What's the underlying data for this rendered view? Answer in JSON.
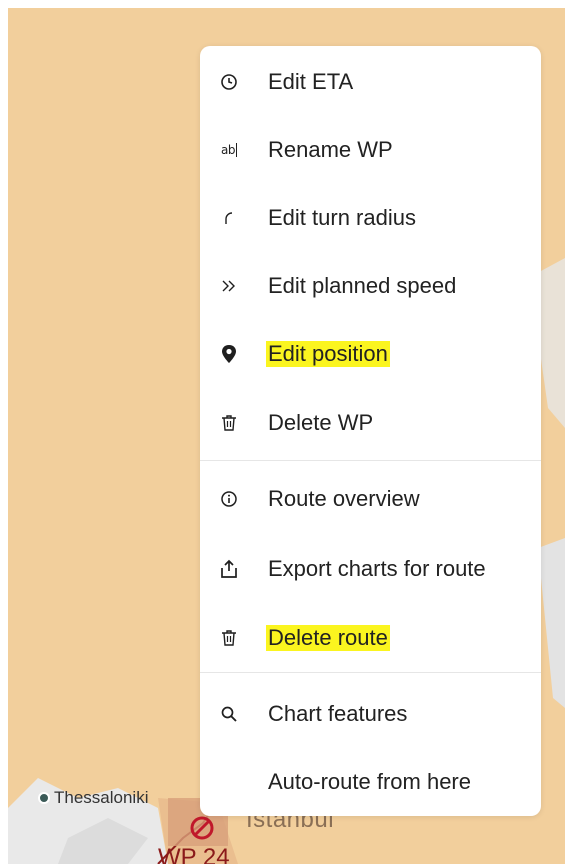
{
  "map": {
    "city_label": "Thessaloniki",
    "istanbul_label": "Istanbul",
    "waypoint_label": "WP 24",
    "colors": {
      "land": "#f2cf9c",
      "sea": "#e6e6e6",
      "route": "#8b1a1a"
    }
  },
  "context_menu": {
    "items": [
      {
        "label": "Edit ETA",
        "icon": "clock-icon",
        "highlighted": false
      },
      {
        "label": "Rename WP",
        "icon": "rename-text-icon",
        "highlighted": false
      },
      {
        "label": "Edit turn radius",
        "icon": "turn-radius-icon",
        "highlighted": false
      },
      {
        "label": "Edit planned speed",
        "icon": "double-chevron-icon",
        "highlighted": false
      },
      {
        "label": "Edit position",
        "icon": "location-pin-icon",
        "highlighted": true
      },
      {
        "label": "Delete WP",
        "icon": "trash-icon",
        "highlighted": false
      },
      {
        "label": "Route overview",
        "icon": "info-icon",
        "highlighted": false
      },
      {
        "label": "Export charts for route",
        "icon": "export-icon",
        "highlighted": false
      },
      {
        "label": "Delete route",
        "icon": "trash-icon",
        "highlighted": true
      },
      {
        "label": "Chart features",
        "icon": "search-icon",
        "highlighted": false
      },
      {
        "label": "Auto-route from here",
        "icon": "",
        "highlighted": false
      }
    ],
    "highlight_color": "#fbf51f"
  }
}
